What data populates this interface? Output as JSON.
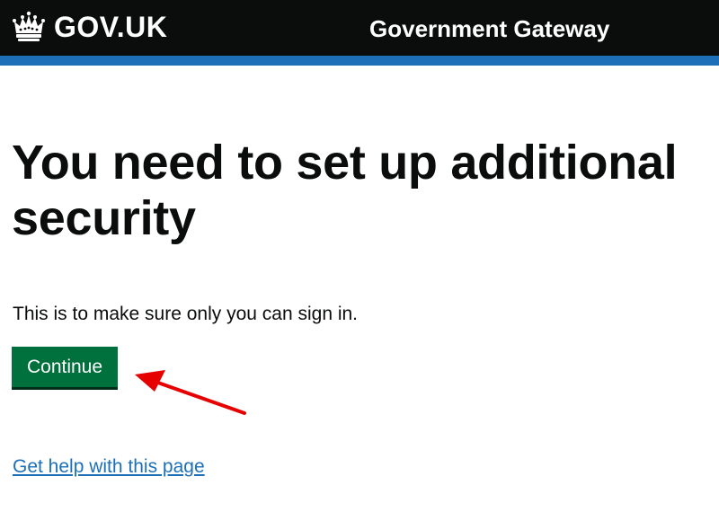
{
  "header": {
    "logo_text": "GOV.UK",
    "service_name": "Government Gateway",
    "logo_icon": "crown-icon"
  },
  "main": {
    "heading": "You need to set up additional security",
    "body": "This is to make sure only you can sign in.",
    "continue_label": "Continue",
    "help_link": "Get help with this page"
  },
  "colors": {
    "header_bg": "#0b0c0c",
    "header_stripe": "#1d70b8",
    "button_green": "#00703c",
    "link_blue": "#1d70b8",
    "annotation_red": "#e60000"
  }
}
